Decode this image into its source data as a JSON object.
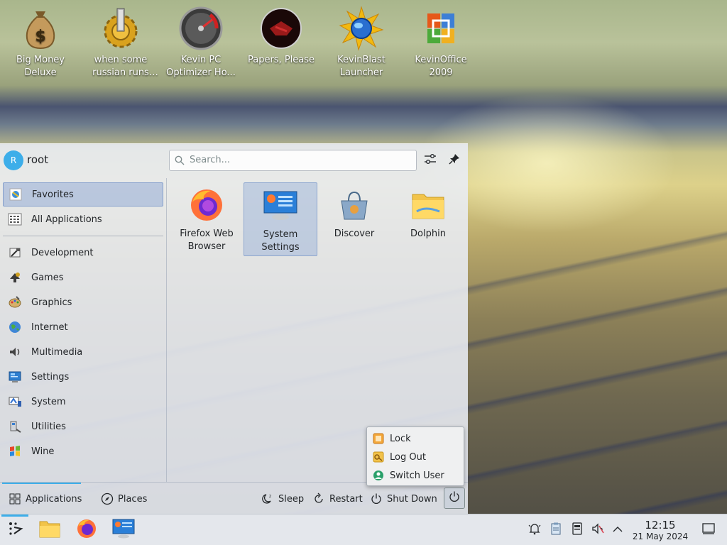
{
  "desktop": {
    "icons": [
      {
        "label": "Big Money Deluxe",
        "icon": "money-bag-icon"
      },
      {
        "label": "when some russian runs a...",
        "icon": "gear-icon"
      },
      {
        "label": "Kevin PC Optimizer Ho...",
        "icon": "speedometer-icon"
      },
      {
        "label": "Papers, Please",
        "icon": "red-emblem-icon"
      },
      {
        "label": "KevinBlast Launcher",
        "icon": "blast-globe-icon"
      },
      {
        "label": "KevinOffice 2009",
        "icon": "office-icon"
      }
    ]
  },
  "launcher": {
    "user": {
      "initial": "R",
      "name": "root"
    },
    "search": {
      "placeholder": "Search..."
    },
    "categories": [
      {
        "label": "Favorites",
        "icon": "star-icon",
        "selected": true
      },
      {
        "label": "All Applications",
        "icon": "grid-icon"
      },
      {
        "label": "Development",
        "icon": "hammer-icon"
      },
      {
        "label": "Games",
        "icon": "gamepad-icon"
      },
      {
        "label": "Graphics",
        "icon": "palette-icon"
      },
      {
        "label": "Internet",
        "icon": "globe-icon"
      },
      {
        "label": "Multimedia",
        "icon": "music-icon"
      },
      {
        "label": "Settings",
        "icon": "settings-icon"
      },
      {
        "label": "System",
        "icon": "computer-icon"
      },
      {
        "label": "Utilities",
        "icon": "tools-icon"
      },
      {
        "label": "Wine",
        "icon": "wine-icon"
      }
    ],
    "favorites": [
      {
        "label": "Firefox Web Browser",
        "icon": "firefox-icon"
      },
      {
        "label": "System Settings",
        "icon": "system-settings-icon",
        "selected": true
      },
      {
        "label": "Discover",
        "icon": "discover-icon"
      },
      {
        "label": "Dolphin",
        "icon": "folder-icon"
      }
    ],
    "footer": {
      "applications": "Applications",
      "places": "Places",
      "sleep": "Sleep",
      "restart": "Restart",
      "shutdown": "Shut Down"
    },
    "session_menu": [
      "Lock",
      "Log Out",
      "Switch User"
    ]
  },
  "taskbar": {
    "time": "12:15",
    "date": "21 May 2024"
  },
  "colors": {
    "accent": "#3daee9",
    "panel": "#e4e7ec"
  }
}
